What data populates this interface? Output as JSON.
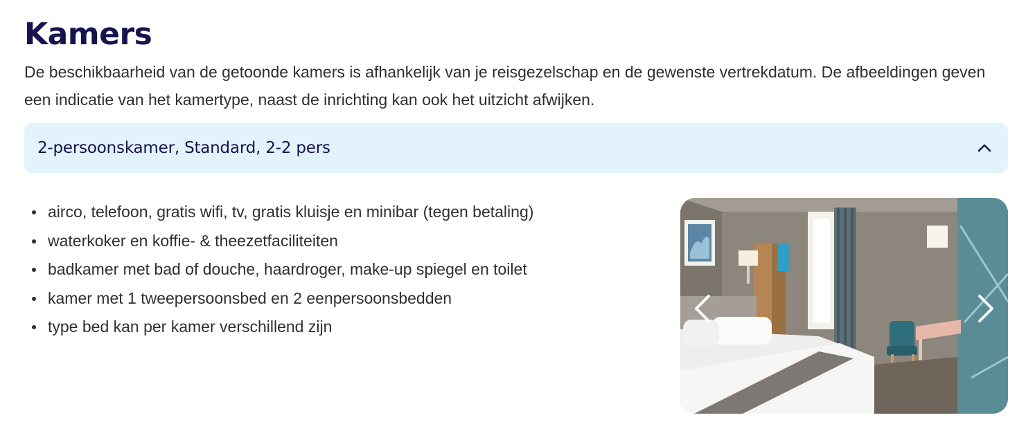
{
  "section": {
    "title": "Kamers",
    "intro": "De beschikbaarheid van de getoonde kamers is afhankelijk van je reisgezelschap en de gewenste vertrekdatum. De afbeeldingen geven een indicatie van het kamertype, naast de inrichting kan ook het uitzicht afwijken."
  },
  "room": {
    "title": "2-persoonskamer, Standard, 2-2 pers",
    "expanded": true,
    "toggle_icon": "chevron-up-icon",
    "features": [
      "airco, telefoon, gratis wifi, tv, gratis kluisje en minibar (tegen betaling)",
      "waterkoker en koffie- & theezetfaciliteiten",
      "badkamer met bad of douche, haardroger, make-up spiegel en toilet",
      "kamer met 1 tweepersoonsbed en 2 eenpersoonsbedden",
      "type bed kan per kamer verschillend zijn"
    ],
    "gallery": {
      "prev_icon": "chevron-left-icon",
      "next_icon": "chevron-right-icon"
    }
  },
  "colors": {
    "heading": "#16134f",
    "accordion_bg": "#e3f3fb",
    "body_text": "#2f2f2f"
  }
}
